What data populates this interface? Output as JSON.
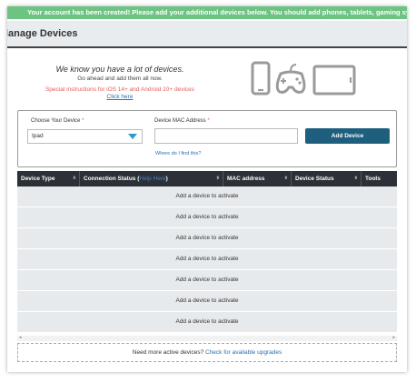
{
  "banner": {
    "text": "Your account has been created! Please add your additional devices below. You should add phones, tablets, gaming systems..."
  },
  "page": {
    "title": "lanage Devices"
  },
  "intro": {
    "headline": "We know you have a lot of devices.",
    "subline": "Go ahead and add them all now.",
    "special": "Special instructions for iOS 14+ and Android 10+ devices",
    "click_here": "Click here"
  },
  "device_icons": [
    "phone-icon",
    "gamepad-icon",
    "tablet-icon"
  ],
  "form": {
    "device_label": "Choose Your Device",
    "device_value": "Ipad",
    "mac_label": "Device MAC Address",
    "mac_value": "",
    "required_mark": "*",
    "help_link": "Where do I find this?",
    "add_button": "Add Device"
  },
  "table": {
    "columns": [
      "Device Type",
      "Connection Status (",
      "Help Here",
      ")",
      "MAC address",
      "Device Status",
      "Tools"
    ],
    "rows": [
      "Add a device to activate",
      "Add a device to activate",
      "Add a device to activate",
      "Add a device to activate",
      "Add a device to activate",
      "Add a device to activate",
      "Add a device to activate"
    ]
  },
  "upgrade": {
    "text": "Need more active devices?",
    "link": "Check for available upgrades"
  },
  "colors": {
    "banner": "#6cc382",
    "header": "#2c3138",
    "button": "#1f5f7e",
    "accent": "#2a9bc8",
    "alert": "#e45b5b"
  }
}
